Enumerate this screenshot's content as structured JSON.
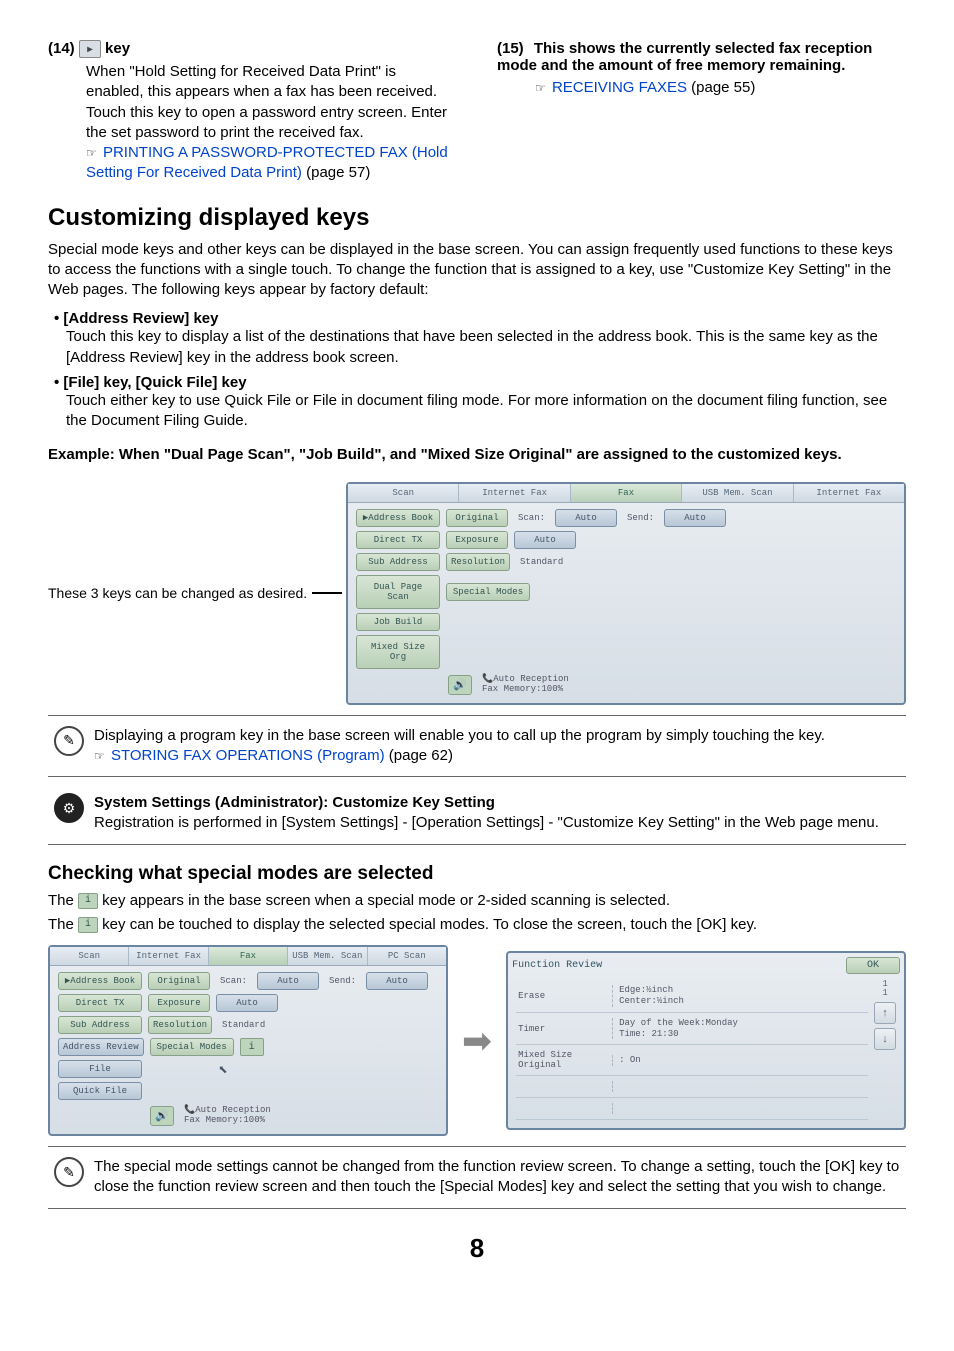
{
  "items": {
    "i14": {
      "num": "(14)",
      "suffix": " key",
      "body": "When \"Hold Setting for Received Data Print\" is enabled, this appears when a fax has been received. Touch this key to open a password entry screen. Enter the set password to print the received fax.",
      "link": "PRINTING A PASSWORD-PROTECTED FAX (Hold Setting For Received Data Print)",
      "linkSuffix": " (page 57)"
    },
    "i15": {
      "num": "(15)",
      "title": "This shows the currently selected fax reception mode and the amount of free memory remaining.",
      "link": "RECEIVING FAXES",
      "linkSuffix": " (page 55)"
    }
  },
  "h_custom": "Customizing displayed keys",
  "p_custom": "Special mode keys and other keys can be displayed in the base screen. You can assign frequently used functions to these keys to access the functions with a single touch. To change the function that is assigned to a key, use \"Customize Key Setting\" in the Web pages. The following keys appear by factory default:",
  "bullets": {
    "b1h": "• [Address Review] key",
    "b1b": "Touch this key to display a list of the destinations that have been selected in the address book. This is the same key as the [Address Review] key in the address book screen.",
    "b2h": "• [File] key, [Quick File] key",
    "b2b": "Touch either key to use Quick File or File in document filing mode. For more information on the document filing function, see the Document Filing Guide."
  },
  "example": "Example: When \"Dual Page Scan\", \"Job Build\", and \"Mixed Size Original\" are assigned to the customized keys.",
  "caption3": "These 3 keys can be changed as desired.",
  "mock1": {
    "tabs": [
      "Scan",
      "Internet Fax",
      "Fax",
      "USB Mem. Scan",
      "Internet Fax"
    ],
    "addressBook": "Address Book",
    "original": "Original",
    "scan": "Scan:",
    "auto": "Auto",
    "send": "Send:",
    "auto2": "Auto",
    "directTx": "Direct TX",
    "exposure": "Exposure",
    "autoE": "Auto",
    "subAddress": "Sub Address",
    "resolution": "Resolution",
    "standard": "Standard",
    "dualPage": "Dual Page\nScan",
    "specialModes": "Special Modes",
    "jobBuild": "Job Build",
    "mixedSize": "Mixed Size\nOrg",
    "footer1": "Auto Reception",
    "footer2": "Fax Memory:100%"
  },
  "note1a": "Displaying a program key in the base screen will enable you to call up the program by simply touching the key.",
  "note1link": "STORING FAX OPERATIONS (Program)",
  "note1suffix": " (page 62)",
  "note2h": "System Settings (Administrator): Customize Key Setting",
  "note2b": "Registration is performed in [System Settings] - [Operation Settings] - \"Customize Key Setting\" in the Web page menu.",
  "h_check": "Checking what special modes are selected",
  "p_check1a": "The ",
  "p_check1b": " key appears in the base screen when a special mode or 2-sided scanning is selected.",
  "p_check2a": "The ",
  "p_check2b": " key can be touched to display the selected special modes. To close the screen, touch the [OK] key.",
  "mock2": {
    "tabs": [
      "Scan",
      "Internet Fax",
      "Fax",
      "USB Mem. Scan",
      "PC Scan"
    ],
    "addressBook": "Address Book",
    "original": "Original",
    "scan": "Scan:",
    "auto": "Auto",
    "send": "Send:",
    "auto2": "Auto",
    "directTx": "Direct TX",
    "exposure": "Exposure",
    "autoE": "Auto",
    "subAddress": "Sub Address",
    "resolution": "Resolution",
    "standard": "Standard",
    "addressReview": "Address Review",
    "specialModes": "Special Modes",
    "file": "File",
    "quickFile": "Quick File",
    "footer1": "Auto Reception",
    "footer2": "Fax Memory:100%"
  },
  "review": {
    "title": "Function Review",
    "ok": "OK",
    "r1l": "Erase",
    "r1v": "Edge:½inch\nCenter:½inch",
    "r2l": "Timer",
    "r2v": "Day of the Week:Monday\nTime: 21:30",
    "r3l": "Mixed Size Original",
    "r3v": ": On",
    "pg": "1\n1"
  },
  "note3": "The special mode settings cannot be changed from the function review screen. To change a setting, touch the [OK] key to close the function review screen and then touch the [Special Modes] key and select the setting that you wish to change.",
  "pageNum": "8"
}
